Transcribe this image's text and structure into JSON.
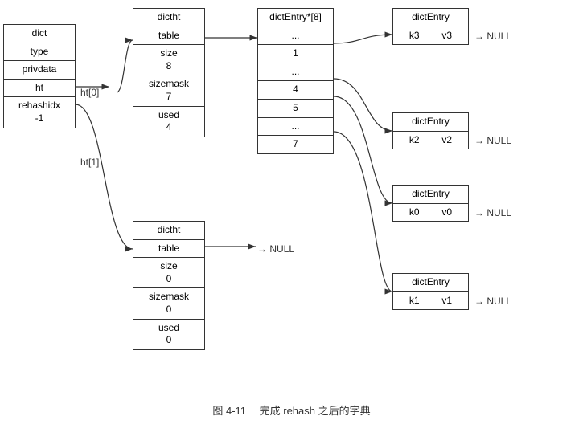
{
  "diagram": {
    "title": "图 4-11　 完成 rehash 之后的字典",
    "dict_box": {
      "label": "dict",
      "cells": [
        "dict",
        "type",
        "privdata",
        "ht",
        "rehashidx\n-1"
      ]
    },
    "ht0_label": "ht[0]",
    "ht1_label": "ht[1]",
    "dictht0": {
      "header": "dictht",
      "cells": [
        "table",
        "size\n8",
        "sizemask\n7",
        "used\n4"
      ]
    },
    "dictht1": {
      "header": "dictht",
      "cells": [
        "table",
        "size\n0",
        "sizemask\n0",
        "used\n0"
      ]
    },
    "array": {
      "header": "dictEntry*[8]",
      "cells": [
        "...",
        "1",
        "...",
        "4",
        "5",
        "...",
        "7"
      ]
    },
    "entries": [
      {
        "header": "dictEntry",
        "k": "k3",
        "v": "v3"
      },
      {
        "header": "dictEntry",
        "k": "k2",
        "v": "v2"
      },
      {
        "header": "dictEntry",
        "k": "k0",
        "v": "v0"
      },
      {
        "header": "dictEntry",
        "k": "k1",
        "v": "v1"
      }
    ],
    "null_labels": [
      "NULL",
      "NULL",
      "NULL",
      "NULL",
      "NULL"
    ]
  }
}
